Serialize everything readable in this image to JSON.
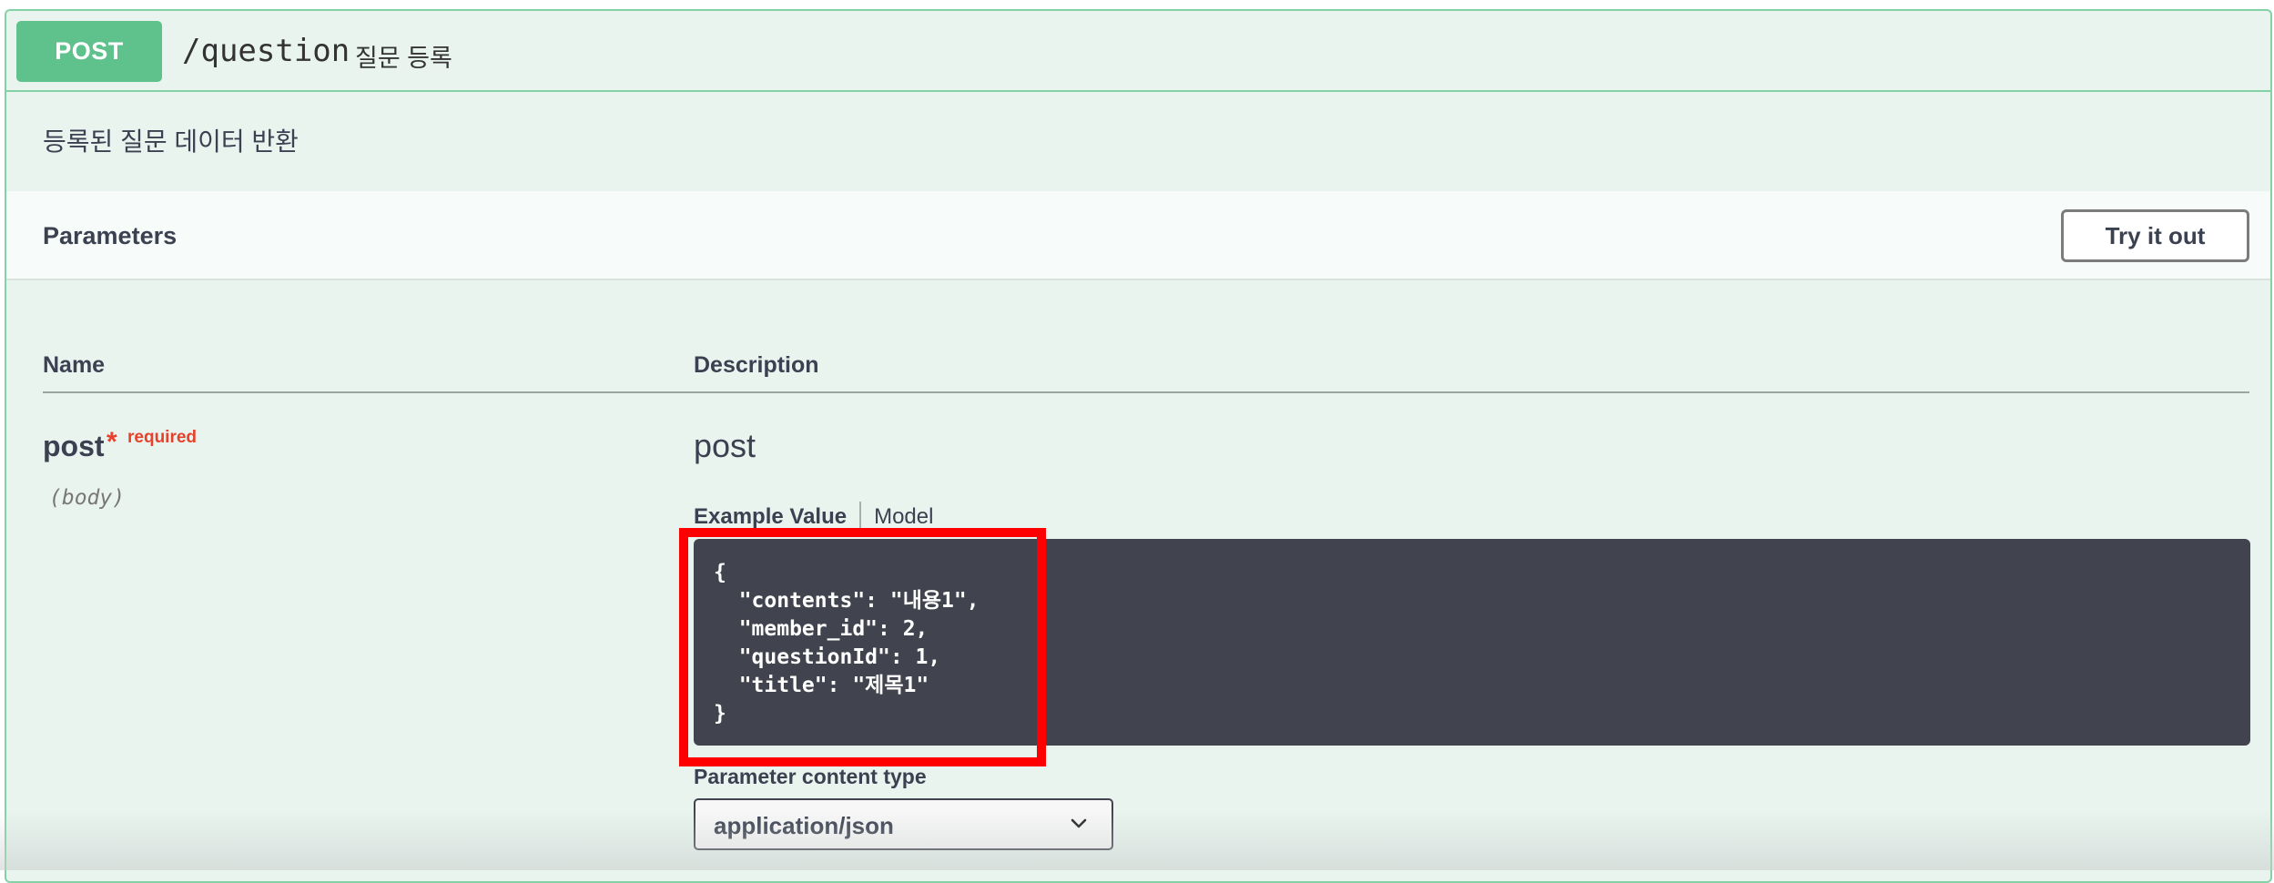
{
  "endpoint": {
    "method": "POST",
    "path": "/question",
    "summary": "질문 등록",
    "description": "등록된 질문 데이터 반환"
  },
  "parameters_section": {
    "title": "Parameters",
    "try_button": "Try it out"
  },
  "table": {
    "col_name": "Name",
    "col_description": "Description"
  },
  "param": {
    "name": "post",
    "star": "*",
    "required": "required",
    "in": "(body)",
    "description": "post"
  },
  "example": {
    "tab_active": "Example Value",
    "tab_model": "Model",
    "code": "{\n  \"contents\": \"내용1\",\n  \"member_id\": 2,\n  \"questionId\": 1,\n  \"title\": \"제목1\"\n}"
  },
  "content_type": {
    "label": "Parameter content type",
    "value": "application/json"
  },
  "icons": {
    "select_chevron": "chevron-down-icon"
  },
  "colors": {
    "method_bg": "#5fc28c",
    "block_bg": "#e9f4ef",
    "block_border": "#84d1a6",
    "code_bg": "#41444e",
    "highlight": "#ff0000",
    "required": "#e8412b"
  }
}
